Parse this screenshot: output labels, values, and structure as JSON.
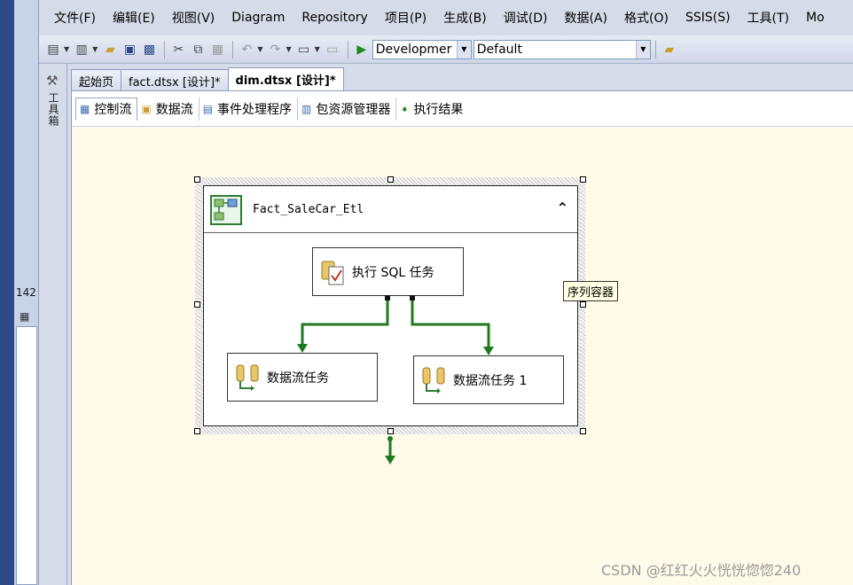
{
  "menu": {
    "items": [
      "文件(F)",
      "编辑(E)",
      "视图(V)",
      "Diagram",
      "Repository",
      "项目(P)",
      "生成(B)",
      "调试(D)",
      "数据(A)",
      "格式(O)",
      "SSIS(S)",
      "工具(T)",
      "Mo"
    ]
  },
  "toolbar": {
    "config_combo": "Developmer",
    "platform_combo": "Default"
  },
  "left_panel": {
    "line_number": "142"
  },
  "toolbox": {
    "label": "工具箱"
  },
  "doc_tabs": [
    "起始页",
    "fact.dtsx [设计]*",
    "dim.dtsx [设计]*"
  ],
  "designer_tabs": [
    "控制流",
    "数据流",
    "事件处理程序",
    "包资源管理器",
    "执行结果"
  ],
  "container": {
    "title": "Fact_SaleCar_Etl",
    "tooltip": "序列容器"
  },
  "tasks": {
    "sql": "执行 SQL 任务",
    "dataflow1": "数据流任务",
    "dataflow2": "数据流任务 1"
  },
  "colors": {
    "precedence_success": "#1f7a1f",
    "canvas_bg": "#fffbe8"
  },
  "watermark": "CSDN @红红火火恍恍惚惚240"
}
